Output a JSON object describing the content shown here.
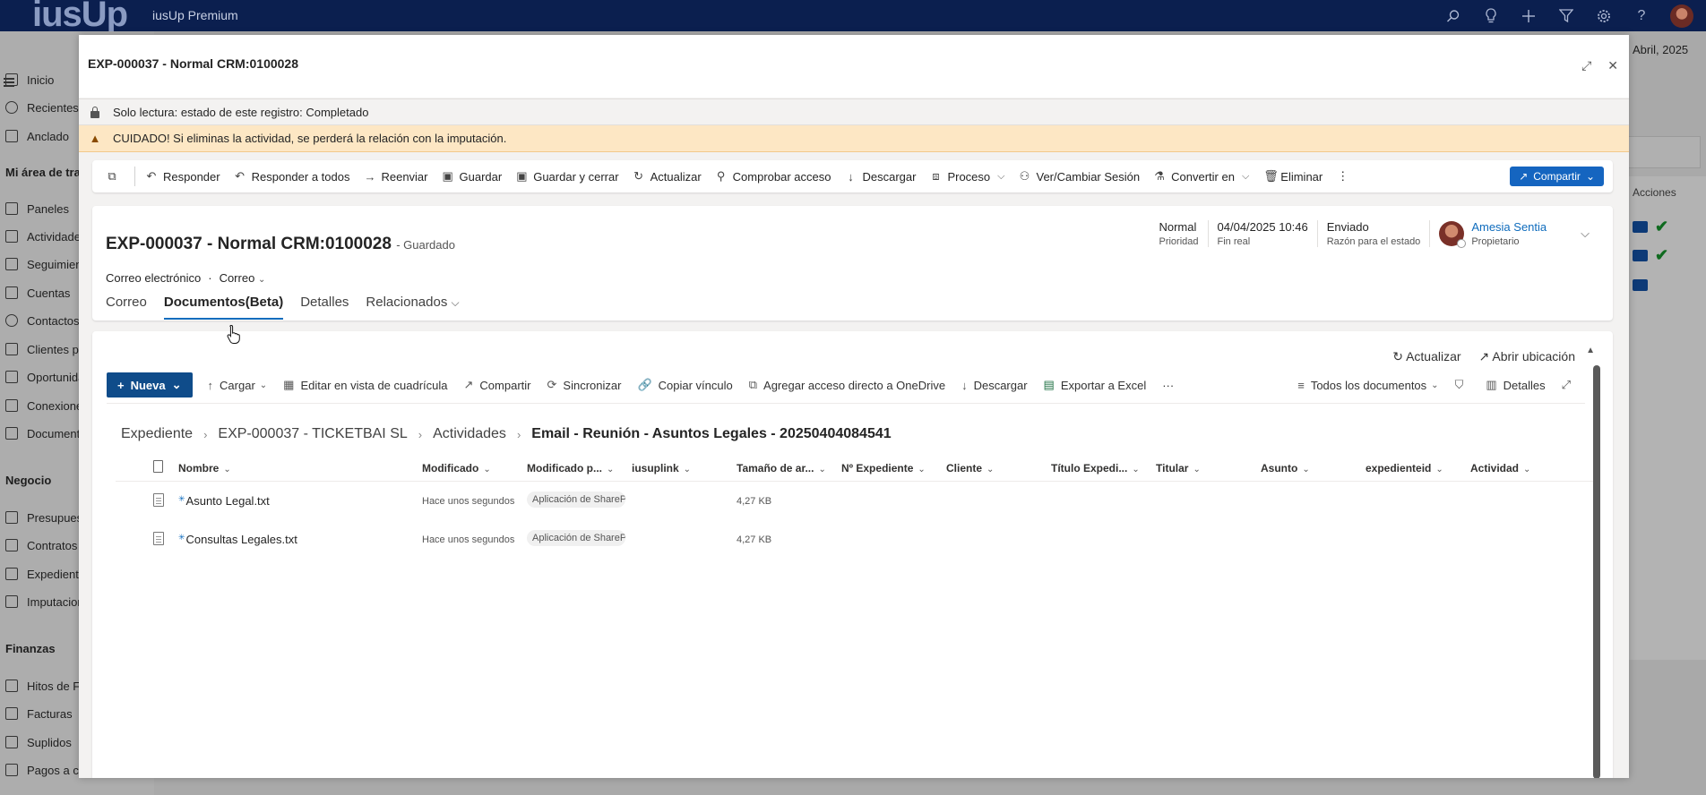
{
  "topbar": {
    "logo": "iusUp",
    "product": "iusUp Premium",
    "icons": [
      "search-icon",
      "lightbulb-icon",
      "plus-icon",
      "filter-icon",
      "gear-icon",
      "help-icon"
    ]
  },
  "background": {
    "sidebar": {
      "items_top": [
        "Inicio",
        "Recientes",
        "Anclado"
      ],
      "section1": "Mi área de trabajo",
      "items1": [
        "Paneles",
        "Actividades",
        "Seguimiento",
        "Cuentas",
        "Contactos",
        "Clientes potenciales",
        "Oportunidades",
        "Conexiones",
        "Documentos"
      ],
      "section2": "Negocio",
      "items2": [
        "Presupuestos",
        "Contratos",
        "Expedientes",
        "Imputaciones"
      ],
      "section3": "Finanzas",
      "items3": [
        "Hitos de Facturación",
        "Facturas",
        "Suplidos",
        "Pagos a cuenta"
      ]
    },
    "right_date": "Abril, 2025",
    "right_header": "Acciones"
  },
  "modal": {
    "title": "EXP-000037 - Normal CRM:0100028",
    "readonly_notice": "Solo lectura: estado de este registro: Completado",
    "warning_notice": "CUIDADO! Si eliminas la actividad, se perderá la relación con la imputación.",
    "commands": {
      "responder": "Responder",
      "responder_todos": "Responder a todos",
      "reenviar": "Reenviar",
      "guardar": "Guardar",
      "guardar_cerrar": "Guardar y cerrar",
      "actualizar": "Actualizar",
      "comprobar": "Comprobar acceso",
      "descargar": "Descargar",
      "proceso": "Proceso",
      "sesion": "Ver/Cambiar Sesión",
      "convertir": "Convertir en",
      "eliminar": "Eliminar",
      "compartir": "Compartir"
    },
    "record": {
      "title": "EXP-000037 - Normal CRM:0100028",
      "save_status": "- Guardado",
      "entity": "Correo electrónico",
      "form": "Correo",
      "fields": [
        {
          "value": "Normal",
          "label": "Prioridad"
        },
        {
          "value": "04/04/2025 10:46",
          "label": "Fin real"
        },
        {
          "value": "Enviado",
          "label": "Razón para el estado"
        }
      ],
      "owner_name": "Amesia Sentia",
      "owner_label": "Propietario",
      "tabs": {
        "correo": "Correo",
        "documentos": "Documentos(Beta)",
        "detalles": "Detalles",
        "relacionados": "Relacionados"
      }
    },
    "documents": {
      "top_actions": {
        "actualizar": "Actualizar",
        "abrir": "Abrir ubicación"
      },
      "toolbar": {
        "nueva": "Nueva",
        "cargar": "Cargar",
        "editar": "Editar en vista de cuadrícula",
        "compartir": "Compartir",
        "sincronizar": "Sincronizar",
        "copiar": "Copiar vínculo",
        "acceso": "Agregar acceso directo a OneDrive",
        "descargar": "Descargar",
        "exportar": "Exportar a Excel",
        "more": "···",
        "vista": "Todos los documentos",
        "detalles": "Detalles"
      },
      "breadcrumb": [
        "Expediente",
        "EXP-000037 - TICKETBAI SL",
        "Actividades",
        "Email - Reunión - Asuntos Legales - 20250404084541"
      ],
      "columns": {
        "nombre": "Nombre",
        "modificado": "Modificado",
        "modificado_por": "Modificado p...",
        "iusuplink": "iusuplink",
        "tamano": "Tamaño de ar...",
        "expediente": "Nº Expediente",
        "cliente": "Cliente",
        "titulo": "Título Expedi...",
        "titular": "Titular",
        "asunto": "Asunto",
        "expedienteid": "expedienteid",
        "actividad": "Actividad"
      },
      "rows": [
        {
          "name": "Asunto Legal.txt",
          "modified": "Hace unos segundos",
          "modified_by": "Aplicación de SharePoint",
          "size": "4,27 KB"
        },
        {
          "name": "Consultas Legales.txt",
          "modified": "Hace unos segundos",
          "modified_by": "Aplicación de SharePoint",
          "size": "4,27 KB"
        }
      ]
    }
  }
}
